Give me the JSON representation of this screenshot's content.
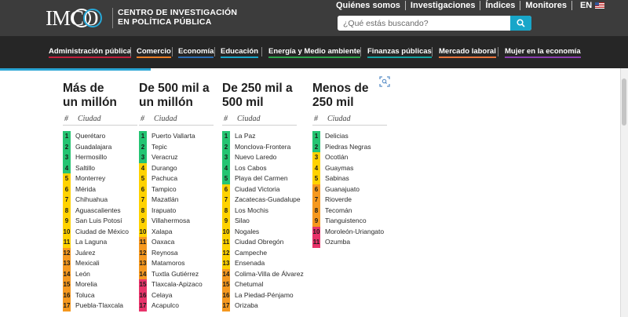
{
  "header": {
    "logo_text": "IMCO",
    "org_line1": "CENTRO DE INVESTIGACIÓN",
    "org_line2": "EN POLÍTICA PÚBLICA",
    "top_links": [
      "Quiénes somos",
      "Investigaciones",
      "Índices",
      "Monitores"
    ],
    "lang_label": "EN",
    "search_placeholder": "¿Qué estás buscando?"
  },
  "menu": {
    "items": [
      {
        "label": "Administración pública",
        "color": "#c41f3c"
      },
      {
        "label": "Comercio",
        "color": "#e97b24"
      },
      {
        "label": "Economía",
        "color": "#2a6db3"
      },
      {
        "label": "Educación",
        "color": "#18a6c9"
      },
      {
        "label": "Energía y Medio ambiente",
        "color": "#2aa44b"
      },
      {
        "label": "Finanzas públicas",
        "color": "#13a3a1"
      },
      {
        "label": "Mercado laboral",
        "color": "#e8743b"
      },
      {
        "label": "Mujer en la economía",
        "color": "#8a3db0"
      }
    ]
  },
  "colors": {
    "green": "#24c472",
    "yellow": "#ffd200",
    "orange": "#f5981f",
    "red": "#e8336a"
  },
  "table_header": {
    "hash": "#",
    "ciudad": "Ciudad"
  },
  "columns": [
    {
      "title_line1": "Más de",
      "title_line2": "un millón",
      "rows": [
        {
          "rank": "1",
          "city": "Querétaro",
          "level": "green"
        },
        {
          "rank": "2",
          "city": "Guadalajara",
          "level": "green"
        },
        {
          "rank": "3",
          "city": "Hermosillo",
          "level": "green"
        },
        {
          "rank": "4",
          "city": "Saltillo",
          "level": "green"
        },
        {
          "rank": "5",
          "city": "Monterrey",
          "level": "yellow"
        },
        {
          "rank": "6",
          "city": "Mérida",
          "level": "yellow"
        },
        {
          "rank": "7",
          "city": "Chihuahua",
          "level": "yellow"
        },
        {
          "rank": "8",
          "city": "Aguascalientes",
          "level": "yellow"
        },
        {
          "rank": "9",
          "city": "San Luis Potosí",
          "level": "yellow"
        },
        {
          "rank": "10",
          "city": "Ciudad de México",
          "level": "yellow"
        },
        {
          "rank": "11",
          "city": "La Laguna",
          "level": "yellow"
        },
        {
          "rank": "12",
          "city": "Juárez",
          "level": "orange"
        },
        {
          "rank": "13",
          "city": "Mexicali",
          "level": "orange"
        },
        {
          "rank": "14",
          "city": "León",
          "level": "orange"
        },
        {
          "rank": "15",
          "city": "Morelia",
          "level": "orange"
        },
        {
          "rank": "16",
          "city": "Toluca",
          "level": "orange"
        },
        {
          "rank": "17",
          "city": "Puebla-Tlaxcala",
          "level": "orange"
        }
      ]
    },
    {
      "title_line1": "De 500 mil a",
      "title_line2": "un millón",
      "rows": [
        {
          "rank": "1",
          "city": "Puerto Vallarta",
          "level": "green"
        },
        {
          "rank": "2",
          "city": "Tepic",
          "level": "green"
        },
        {
          "rank": "3",
          "city": "Veracruz",
          "level": "green"
        },
        {
          "rank": "4",
          "city": "Durango",
          "level": "yellow"
        },
        {
          "rank": "5",
          "city": "Pachuca",
          "level": "yellow"
        },
        {
          "rank": "6",
          "city": "Tampico",
          "level": "yellow"
        },
        {
          "rank": "7",
          "city": "Mazatlán",
          "level": "yellow"
        },
        {
          "rank": "8",
          "city": "Irapuato",
          "level": "yellow"
        },
        {
          "rank": "9",
          "city": "Villahermosa",
          "level": "yellow"
        },
        {
          "rank": "10",
          "city": "Xalapa",
          "level": "yellow"
        },
        {
          "rank": "11",
          "city": "Oaxaca",
          "level": "orange"
        },
        {
          "rank": "12",
          "city": "Reynosa",
          "level": "orange"
        },
        {
          "rank": "13",
          "city": "Matamoros",
          "level": "orange"
        },
        {
          "rank": "14",
          "city": "Tuxtla Gutiérrez",
          "level": "orange"
        },
        {
          "rank": "15",
          "city": "Tlaxcala-Apizaco",
          "level": "red"
        },
        {
          "rank": "16",
          "city": "Celaya",
          "level": "red"
        },
        {
          "rank": "17",
          "city": "Acapulco",
          "level": "red"
        }
      ]
    },
    {
      "title_line1": "De 250 mil a",
      "title_line2": "500 mil",
      "rows": [
        {
          "rank": "1",
          "city": "La Paz",
          "level": "green"
        },
        {
          "rank": "2",
          "city": "Monclova-Frontera",
          "level": "green"
        },
        {
          "rank": "3",
          "city": "Nuevo Laredo",
          "level": "green"
        },
        {
          "rank": "4",
          "city": "Los Cabos",
          "level": "green"
        },
        {
          "rank": "5",
          "city": "Playa del Carmen",
          "level": "green"
        },
        {
          "rank": "6",
          "city": "Ciudad Victoria",
          "level": "yellow"
        },
        {
          "rank": "7",
          "city": "Zacatecas-Guadalupe",
          "level": "yellow"
        },
        {
          "rank": "8",
          "city": "Los Mochis",
          "level": "yellow"
        },
        {
          "rank": "9",
          "city": "Silao",
          "level": "yellow"
        },
        {
          "rank": "10",
          "city": "Nogales",
          "level": "yellow"
        },
        {
          "rank": "11",
          "city": "Ciudad Obregón",
          "level": "yellow"
        },
        {
          "rank": "12",
          "city": "Campeche",
          "level": "yellow"
        },
        {
          "rank": "13",
          "city": "Ensenada",
          "level": "yellow"
        },
        {
          "rank": "14",
          "city": "Colima-Villa de Álvarez",
          "level": "orange"
        },
        {
          "rank": "15",
          "city": "Chetumal",
          "level": "orange"
        },
        {
          "rank": "16",
          "city": "La Piedad-Pénjamo",
          "level": "orange"
        },
        {
          "rank": "17",
          "city": "Orizaba",
          "level": "orange"
        }
      ]
    },
    {
      "title_line1": "Menos de",
      "title_line2": "250 mil",
      "rows": [
        {
          "rank": "1",
          "city": "Delicias",
          "level": "green"
        },
        {
          "rank": "2",
          "city": "Piedras Negras",
          "level": "green"
        },
        {
          "rank": "3",
          "city": "Ocotlán",
          "level": "yellow"
        },
        {
          "rank": "4",
          "city": "Guaymas",
          "level": "yellow"
        },
        {
          "rank": "5",
          "city": "Sabinas",
          "level": "yellow"
        },
        {
          "rank": "6",
          "city": "Guanajuato",
          "level": "orange"
        },
        {
          "rank": "7",
          "city": "Rioverde",
          "level": "orange"
        },
        {
          "rank": "8",
          "city": "Tecomán",
          "level": "orange"
        },
        {
          "rank": "9",
          "city": "Tianguistenco",
          "level": "orange"
        },
        {
          "rank": "10",
          "city": "Moroleón-Uriangato",
          "level": "red"
        },
        {
          "rank": "11",
          "city": "Ozumba",
          "level": "red"
        }
      ]
    }
  ]
}
